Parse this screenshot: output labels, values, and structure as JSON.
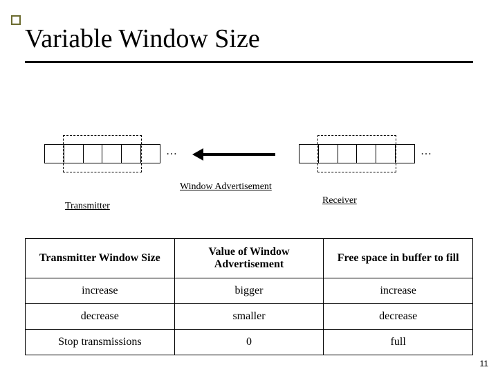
{
  "title": "Variable Window Size",
  "diagram": {
    "ellipsis_left": "…",
    "ellipsis_right": "…",
    "label_winadv": "Window Advertisement",
    "label_transmitter": "Transmitter",
    "label_receiver": "Receiver"
  },
  "table": {
    "headers": [
      "Transmitter Window Size",
      "Value of\nWindow Advertisement",
      "Free space in buffer to fill"
    ],
    "rows": [
      [
        "increase",
        "bigger",
        "increase"
      ],
      [
        "decrease",
        "smaller",
        "decrease"
      ],
      [
        "Stop transmissions",
        "0",
        "full"
      ]
    ]
  },
  "slide_number": "11"
}
